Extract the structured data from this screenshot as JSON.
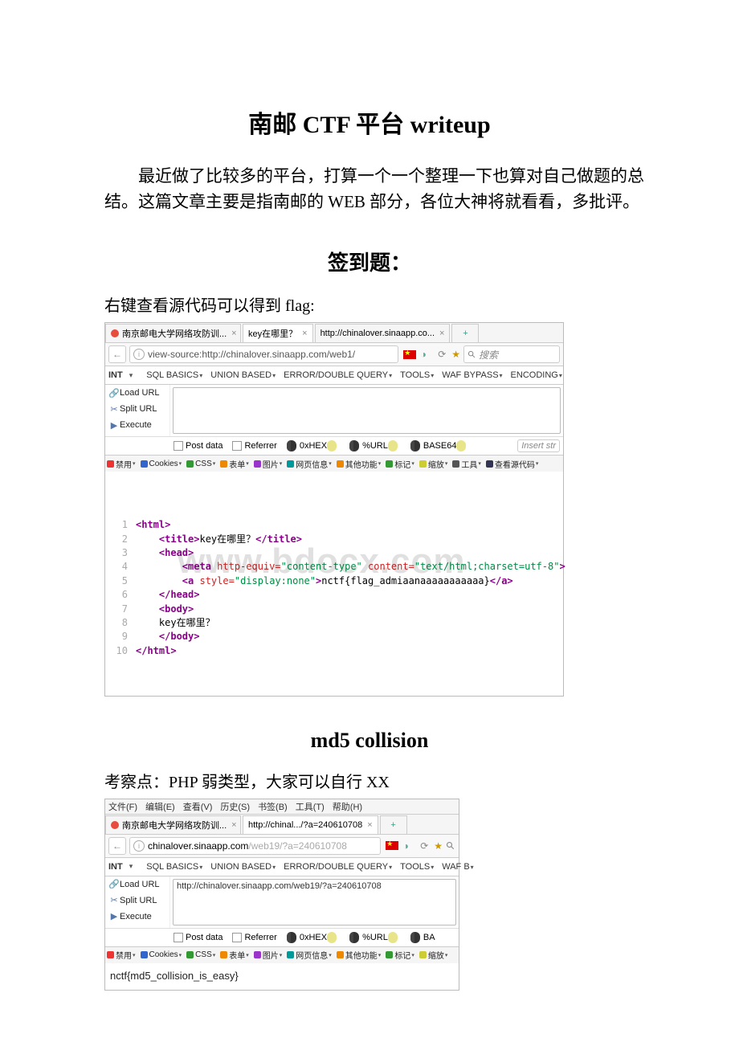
{
  "doc": {
    "title": "南邮 CTF 平台 writeup",
    "intro": "最近做了比较多的平台，打算一个一个整理一下也算对自己做题的总结。这篇文章主要是指南邮的 WEB 部分，各位大神将就看看，多批评。"
  },
  "section1": {
    "heading": "签到题：",
    "desc": "右键查看源代码可以得到 flag:"
  },
  "browser1": {
    "tabs": [
      "南京邮电大学网络攻防训...",
      "key在哪里？",
      "http://chinalover.sinaapp.co..."
    ],
    "address_prefix": "view-source:",
    "address": "http://chinalover.sinaapp.com/web1/",
    "search_placeholder": "搜索",
    "hackbar": {
      "label": "INT",
      "menus": [
        "SQL BASICS",
        "UNION BASED",
        "ERROR/DOUBLE QUERY",
        "TOOLS",
        "WAF BYPASS",
        "ENCODING"
      ],
      "side": [
        {
          "icon": "link",
          "label": "Load URL"
        },
        {
          "icon": "split",
          "label": "Split URL"
        },
        {
          "icon": "play",
          "label": "Execute"
        }
      ],
      "bottom_post": "Post data",
      "bottom_ref": "Referrer",
      "bottom_hex": "0xHEX",
      "bottom_url": "%URL",
      "bottom_b64": "BASE64",
      "insert": "Insert str"
    },
    "devbar": [
      "禁用",
      "Cookies",
      "CSS",
      "表单",
      "图片",
      "网页信息",
      "其他功能",
      "标记",
      "缩放",
      "工具",
      "查看源代码"
    ],
    "src_lines": [
      {
        "n": "1",
        "html": "<span class='t-tag'>&lt;html&gt;</span>"
      },
      {
        "n": "2",
        "html": "    <span class='t-tag'>&lt;title&gt;</span><span class='t-txt'>key在哪里？</span><span class='t-tag'>&lt;/title&gt;</span>"
      },
      {
        "n": "3",
        "html": "    <span class='t-tag'>&lt;head&gt;</span>"
      },
      {
        "n": "4",
        "html": "        <span class='t-tag'>&lt;meta</span> <span class='t-attr'>http-equiv=</span><span class='t-str'>\"content-type\"</span> <span class='t-attr'>content=</span><span class='t-str'>\"text/html;charset=utf-8\"</span><span class='t-tag'>&gt;</span>"
      },
      {
        "n": "5",
        "html": "        <span class='t-tag'>&lt;a</span> <span class='t-attr'>style=</span><span class='t-str'>\"display:none\"</span><span class='t-tag'>&gt;</span><span class='t-txt'>nctf{flag_admiaanaaaaaaaaaaa}</span><span class='t-tag'>&lt;/a&gt;</span>"
      },
      {
        "n": "6",
        "html": "    <span class='t-tag'>&lt;/head&gt;</span>"
      },
      {
        "n": "7",
        "html": "    <span class='t-tag'>&lt;body&gt;</span>"
      },
      {
        "n": "8",
        "html": "    <span class='t-txt'>key在哪里？</span>"
      },
      {
        "n": "9",
        "html": "    <span class='t-tag'>&lt;/body&gt;</span>"
      },
      {
        "n": "10",
        "html": "<span class='t-tag'>&lt;/html&gt;</span>"
      }
    ],
    "watermark": "www.bdocx.com"
  },
  "section2": {
    "heading": "md5 collision",
    "desc": "考察点：PHP 弱类型，大家可以自行 XX"
  },
  "browser2": {
    "menubar": [
      "文件(F)",
      "编辑(E)",
      "查看(V)",
      "历史(S)",
      "书签(B)",
      "工具(T)",
      "帮助(H)"
    ],
    "tabs": [
      "南京邮电大学网络攻防训...",
      "http://chinal.../?a=240610708"
    ],
    "address_host": "chinalover.sinaapp.com",
    "address_path": "/web19/?a=240610708",
    "hackbar": {
      "label": "INT",
      "menus": [
        "SQL BASICS",
        "UNION BASED",
        "ERROR/DOUBLE QUERY",
        "TOOLS",
        "WAF B"
      ],
      "side": [
        {
          "icon": "link",
          "label": "Load URL"
        },
        {
          "icon": "split",
          "label": "Split URL"
        },
        {
          "icon": "play",
          "label": "Execute"
        }
      ],
      "input": "http://chinalover.sinaapp.com/web19/?a=240610708",
      "bottom_post": "Post data",
      "bottom_ref": "Referrer",
      "bottom_hex": "0xHEX",
      "bottom_url": "%URL",
      "bottom_b64": "BA"
    },
    "devbar": [
      "禁用",
      "Cookies",
      "CSS",
      "表单",
      "图片",
      "网页信息",
      "其他功能",
      "标记",
      "缩放"
    ],
    "result": "nctf{md5_collision_is_easy}"
  }
}
